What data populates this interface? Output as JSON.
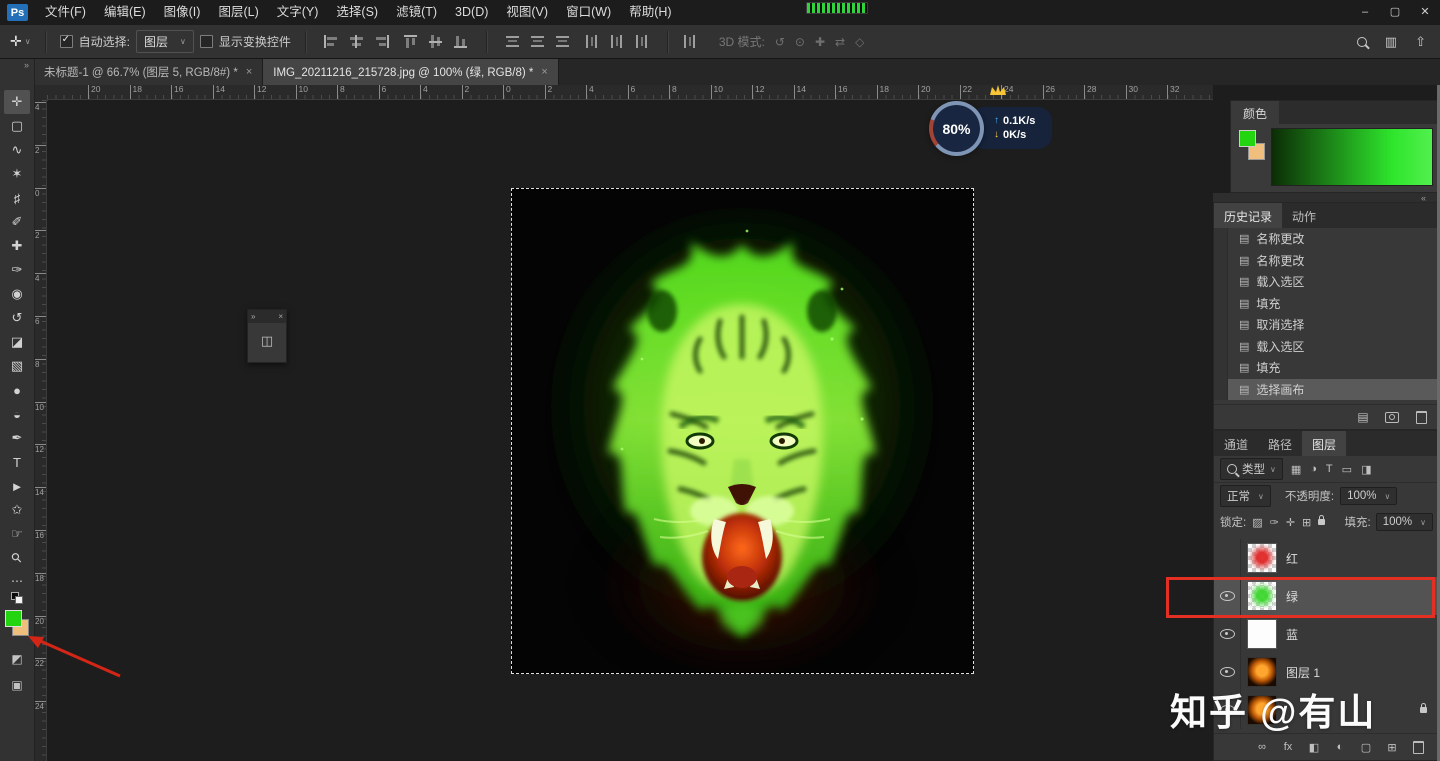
{
  "titlebar": {
    "app_icon": "Ps",
    "menus": [
      "文件(F)",
      "编辑(E)",
      "图像(I)",
      "图层(L)",
      "文字(Y)",
      "选择(S)",
      "滤镜(T)",
      "3D(D)",
      "视图(V)",
      "窗口(W)",
      "帮助(H)"
    ],
    "window_controls": {
      "minimize": "–",
      "restore": "▢",
      "close": "✕"
    }
  },
  "options": {
    "tool_glyph": "✛",
    "auto_select_label": "自动选择:",
    "auto_select_value": "图层",
    "show_transform_label": "显示变换控件",
    "mode3d_label": "3D 模式:",
    "mode3d_icons": [
      {
        "name": "3d-rotate-icon",
        "glyph": "↺"
      },
      {
        "name": "3d-roll-icon",
        "glyph": "⊙"
      },
      {
        "name": "3d-drag-icon",
        "glyph": "✚"
      },
      {
        "name": "3d-slide-icon",
        "glyph": "⇄"
      },
      {
        "name": "3d-scale-icon",
        "glyph": "◇"
      }
    ],
    "workspace_glyph": "▥",
    "share_glyph": "⇧"
  },
  "tabs": [
    {
      "label": "未标题-1 @ 66.7% (图层 5, RGB/8#) *",
      "close": "×",
      "active": false
    },
    {
      "label": "IMG_20211216_215728.jpg @ 100% (绿, RGB/8) *",
      "close": "×",
      "active": true
    }
  ],
  "rulers": {
    "horizontal": [
      "20",
      "18",
      "16",
      "14",
      "12",
      "10",
      "8",
      "6",
      "4",
      "2",
      "0",
      "2",
      "4",
      "6",
      "8",
      "10",
      "12",
      "14",
      "16",
      "18",
      "20",
      "22",
      "24",
      "26",
      "28",
      "30",
      "32"
    ],
    "vertical": [
      "4",
      "2",
      "0",
      "2",
      "4",
      "6",
      "8",
      "10",
      "12",
      "14",
      "16",
      "18",
      "20",
      "22",
      "24"
    ]
  },
  "toolbar": {
    "collapse_glyph": "»",
    "more_glyph": "⋯",
    "fg_color": "#23d411",
    "bg_color": "#f0bf7e",
    "quick_mask_glyph": "◩",
    "screen_mode_glyph": "▣"
  },
  "tools": [
    {
      "name": "move-tool",
      "glyph": "✛",
      "selected": true
    },
    {
      "name": "marquee-tool",
      "glyph": "▢"
    },
    {
      "name": "lasso-tool",
      "glyph": "∿"
    },
    {
      "name": "magic-wand-tool",
      "glyph": "✶"
    },
    {
      "name": "crop-tool",
      "glyph": "♯"
    },
    {
      "name": "eyedropper-tool",
      "glyph": "✐"
    },
    {
      "name": "healing-brush-tool",
      "glyph": "✚"
    },
    {
      "name": "brush-tool",
      "glyph": "✑"
    },
    {
      "name": "clone-stamp-tool",
      "glyph": "◉"
    },
    {
      "name": "history-brush-tool",
      "glyph": "↺"
    },
    {
      "name": "eraser-tool",
      "glyph": "◪"
    },
    {
      "name": "gradient-tool",
      "glyph": "▧"
    },
    {
      "name": "blur-tool",
      "glyph": "●"
    },
    {
      "name": "dodge-tool",
      "glyph": "◒"
    },
    {
      "name": "pen-tool",
      "glyph": "✒"
    },
    {
      "name": "type-tool",
      "glyph": "T"
    },
    {
      "name": "path-select-tool",
      "glyph": "►"
    },
    {
      "name": "shape-tool",
      "glyph": "✩"
    },
    {
      "name": "hand-tool",
      "glyph": "☞"
    },
    {
      "name": "zoom-tool",
      "glyph": "⚲",
      "mag": true
    }
  ],
  "mini_panel": {
    "collapse": "»",
    "close": "×",
    "icon": "◫"
  },
  "net_badge": {
    "percent": "80%",
    "up_arrow": "↑",
    "up_speed": "0.1K/s",
    "down_arrow": "↓",
    "down_speed": "0K/s"
  },
  "color_panel": {
    "title": "颜色",
    "foreground": "#23d411",
    "background": "#f0bf7e"
  },
  "collapse_bar": {
    "glyph": "«"
  },
  "history_panel": {
    "tabs": [
      {
        "label": "历史记录",
        "active": true
      },
      {
        "label": "动作",
        "active": false
      }
    ],
    "menu_glyph": "≡",
    "items": [
      {
        "icon": "▤",
        "label": "名称更改"
      },
      {
        "icon": "▤",
        "label": "名称更改"
      },
      {
        "icon": "▤",
        "label": "载入选区"
      },
      {
        "icon": "▤",
        "label": "填充"
      },
      {
        "icon": "▤",
        "label": "取消选择"
      },
      {
        "icon": "▤",
        "label": "载入选区"
      },
      {
        "icon": "▤",
        "label": "填充"
      },
      {
        "icon": "▤",
        "label": "选择画布",
        "selected": true
      }
    ],
    "bottom_icons": [
      {
        "name": "new-doc-from-state-icon",
        "glyph": "▤"
      },
      {
        "name": "new-snapshot-icon",
        "glyph": "",
        "camera": true
      },
      {
        "name": "delete-state-icon",
        "glyph": "",
        "trash": true
      }
    ]
  },
  "layers_panel": {
    "tabs": [
      {
        "label": "通道",
        "active": false
      },
      {
        "label": "路径",
        "active": false
      },
      {
        "label": "图层",
        "active": true
      }
    ],
    "menu_glyph": "≡",
    "filter_label": "类型",
    "filter_icons": [
      {
        "name": "filter-pixel-icon",
        "glyph": "▦"
      },
      {
        "name": "filter-adjustment-icon",
        "glyph": "◑"
      },
      {
        "name": "filter-type-icon",
        "glyph": "T"
      },
      {
        "name": "filter-shape-icon",
        "glyph": "▭"
      },
      {
        "name": "filter-smart-icon",
        "glyph": "◨"
      }
    ],
    "blend_mode": "正常",
    "opacity_label": "不透明度:",
    "opacity_value": "100%",
    "lock_label": "锁定:",
    "lock_icons": [
      {
        "name": "lock-transparent-icon",
        "glyph": "▨"
      },
      {
        "name": "lock-pixels-icon",
        "glyph": "✑"
      },
      {
        "name": "lock-position-icon",
        "glyph": "✛"
      },
      {
        "name": "lock-artboard-icon",
        "glyph": "⊞"
      },
      {
        "name": "lock-all-icon",
        "glyph": "",
        "lock": true
      }
    ],
    "fill_label": "填充:",
    "fill_value": "100%",
    "layers": [
      {
        "name": "红",
        "visible": false,
        "thumb": "red",
        "selected": false,
        "locked": false
      },
      {
        "name": "绿",
        "visible": true,
        "thumb": "green",
        "selected": true,
        "locked": false
      },
      {
        "name": "蓝",
        "visible": true,
        "thumb": "white",
        "selected": false,
        "locked": false
      },
      {
        "name": "图层 1",
        "visible": true,
        "thumb": "orange",
        "selected": false,
        "locked": false
      },
      {
        "name": "",
        "visible": true,
        "thumb": "orange",
        "selected": false,
        "locked": true
      }
    ],
    "bottom_icons": [
      {
        "name": "link-layers-icon",
        "glyph": "∞"
      },
      {
        "name": "layer-effects-icon",
        "glyph": "fx"
      },
      {
        "name": "layer-mask-icon",
        "glyph": "◧"
      },
      {
        "name": "adjustment-layer-icon",
        "glyph": "◐"
      },
      {
        "name": "layer-group-icon",
        "glyph": "▢"
      },
      {
        "name": "new-layer-icon",
        "glyph": "⊞"
      },
      {
        "name": "delete-layer-icon",
        "glyph": "",
        "trash": true
      }
    ]
  },
  "watermark": "知乎 @有山"
}
